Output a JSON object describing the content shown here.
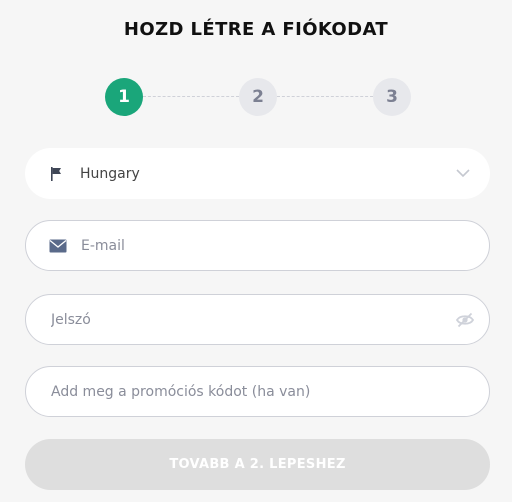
{
  "header": {
    "title": "HOZD LÉTRE A FIÓKODAT"
  },
  "stepper": {
    "steps": [
      {
        "label": "1",
        "state": "active"
      },
      {
        "label": "2",
        "state": "inactive"
      },
      {
        "label": "3",
        "state": "inactive"
      }
    ]
  },
  "form": {
    "country": {
      "value": "Hungary",
      "icon": "flag-icon",
      "dropdown_icon": "chevron-down-icon"
    },
    "email": {
      "placeholder": "E-mail",
      "icon": "envelope-icon"
    },
    "password": {
      "placeholder": "Jelszó",
      "toggle_icon": "eye-slash-icon"
    },
    "promo": {
      "placeholder": "Add meg a promóciós kódot (ha van)"
    },
    "submit_label": "TOVABB A 2. LEPESHEZ"
  },
  "colors": {
    "accent": "#1aa67a",
    "step_inactive_bg": "#e7e8ec",
    "step_inactive_text": "#7c8092",
    "border": "#cfd1d8",
    "button_disabled": "#dedede",
    "background": "#f6f6f6"
  }
}
